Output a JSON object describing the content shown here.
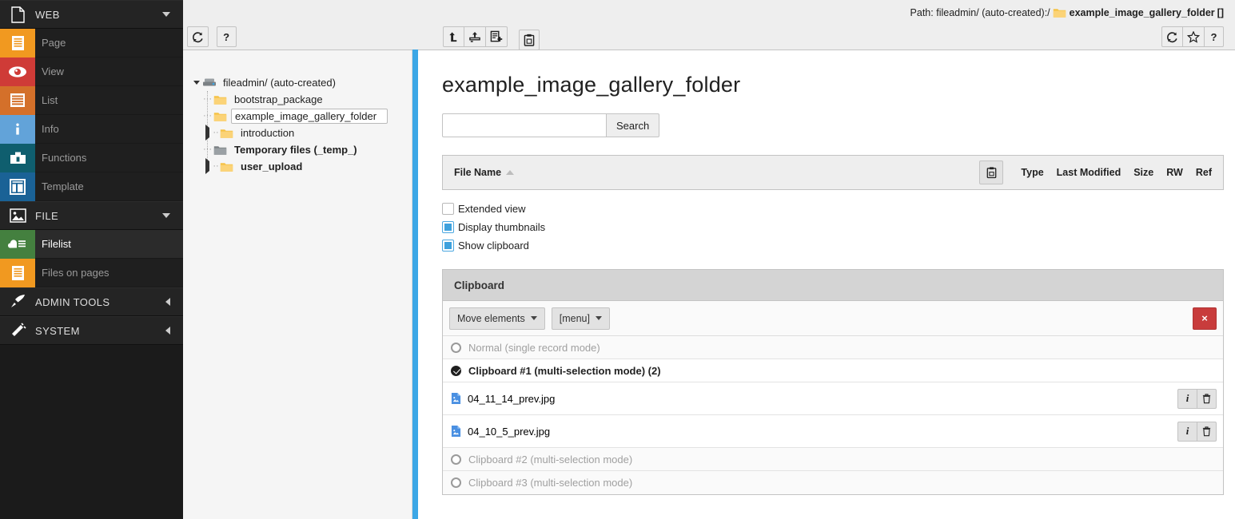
{
  "sidebar": {
    "sections": [
      {
        "key": "web",
        "label": "WEB",
        "icon": "page-doc-icon",
        "caret": "down",
        "items": [
          {
            "label": "Page",
            "icon": "page-icon",
            "color": "#f19920",
            "active": false
          },
          {
            "label": "View",
            "icon": "eye-icon",
            "color": "#cf3b37",
            "active": false
          },
          {
            "label": "List",
            "icon": "list-icon",
            "color": "#d4702a",
            "active": false
          },
          {
            "label": "Info",
            "icon": "info-icon",
            "color": "#62a3d9",
            "active": false
          },
          {
            "label": "Functions",
            "icon": "toolbox-icon",
            "color": "#0f5e6e",
            "active": false
          },
          {
            "label": "Template",
            "icon": "template-icon",
            "color": "#1a6296",
            "active": false
          }
        ]
      },
      {
        "key": "file",
        "label": "FILE",
        "icon": "image-icon",
        "caret": "down",
        "items": [
          {
            "label": "Filelist",
            "icon": "filelist-icon",
            "color": "#44803f",
            "active": true
          },
          {
            "label": "Files on pages",
            "icon": "files-on-pages-icon",
            "color": "#f19920",
            "active": false
          }
        ]
      },
      {
        "key": "admin",
        "label": "ADMIN TOOLS",
        "icon": "rocket-icon",
        "caret": "left",
        "items": []
      },
      {
        "key": "system",
        "label": "SYSTEM",
        "icon": "plug-icon",
        "caret": "left",
        "items": []
      }
    ]
  },
  "docheader": {
    "tree_toolbar": [
      {
        "name": "refresh-tree-button",
        "icon": "refresh-icon",
        "label": "↻"
      },
      {
        "name": "tree-help-button",
        "icon": "question-icon",
        "label": "?"
      }
    ],
    "main_toolbar": [
      {
        "name": "level-up-button",
        "icon": "arrow-up-level-icon"
      },
      {
        "name": "upload-files-button",
        "icon": "upload-icon"
      },
      {
        "name": "create-new-button",
        "icon": "new-document-icon"
      },
      {
        "name": "paste-clipboard-button",
        "icon": "clipboard-icon"
      }
    ],
    "right_toolbar": [
      {
        "name": "reload-button",
        "icon": "refresh-icon"
      },
      {
        "name": "bookmark-button",
        "icon": "star-icon"
      },
      {
        "name": "help-button",
        "icon": "question-icon",
        "label": "?"
      }
    ],
    "path": {
      "prefix": "Path:",
      "storage": "fileadmin/ (auto-created):/",
      "folder_icon": "folder-icon",
      "folder": "example_image_gallery_folder",
      "suffix": "[]"
    }
  },
  "tree": {
    "nodes": [
      {
        "label": "fileadmin/ (auto-created)",
        "icon": "storage-icon",
        "depth": 0,
        "expander": "down",
        "bold": false,
        "selected": false
      },
      {
        "label": "bootstrap_package",
        "icon": "folder-icon",
        "depth": 1,
        "expander": "none",
        "bold": false,
        "selected": false
      },
      {
        "label": "example_image_gallery_folder",
        "icon": "folder-icon",
        "depth": 1,
        "expander": "none",
        "bold": false,
        "selected": true
      },
      {
        "label": "introduction",
        "icon": "folder-icon",
        "depth": 1,
        "expander": "right",
        "bold": false,
        "selected": false
      },
      {
        "label": "Temporary files (_temp_)",
        "icon": "folder-temp-icon",
        "depth": 1,
        "expander": "none",
        "bold": true,
        "selected": false
      },
      {
        "label": "user_upload",
        "icon": "folder-icon",
        "depth": 1,
        "expander": "right",
        "bold": true,
        "selected": false
      }
    ]
  },
  "main": {
    "title": "example_image_gallery_folder",
    "search": {
      "value": "",
      "placeholder": "",
      "button_label": "Search"
    },
    "filetable": {
      "sort_column": "File Name",
      "sort_direction": "asc",
      "clipboard_toggle_icon": "clipboard-icon",
      "columns": [
        "Type",
        "Last Modified",
        "Size",
        "RW",
        "Ref"
      ]
    },
    "options": [
      {
        "label": "Extended view",
        "checked": false,
        "name": "extended-view-checkbox"
      },
      {
        "label": "Display thumbnails",
        "checked": true,
        "name": "display-thumbnails-checkbox"
      },
      {
        "label": "Show clipboard",
        "checked": true,
        "name": "show-clipboard-checkbox"
      }
    ],
    "clipboard": {
      "title": "Clipboard",
      "move_menu_label": "Move elements",
      "menu_label": "[menu]",
      "clear_label": "×",
      "rows": [
        {
          "type": "pad",
          "label": "Normal (single record mode)",
          "selected": false
        },
        {
          "type": "pad",
          "label": "Clipboard #1 (multi-selection mode) (2)",
          "selected": true
        },
        {
          "type": "file",
          "label": "04_11_14_prev.jpg",
          "icon": "image-file-icon",
          "actions": [
            {
              "name": "file-info-button",
              "label": "i"
            },
            {
              "name": "file-remove-button",
              "label": "trash"
            }
          ]
        },
        {
          "type": "file",
          "label": "04_10_5_prev.jpg",
          "icon": "image-file-icon",
          "actions": [
            {
              "name": "file-info-button",
              "label": "i"
            },
            {
              "name": "file-remove-button",
              "label": "trash"
            }
          ]
        },
        {
          "type": "pad",
          "label": "Clipboard #2 (multi-selection mode)",
          "selected": false
        },
        {
          "type": "pad",
          "label": "Clipboard #3 (multi-selection mode)",
          "selected": false
        }
      ]
    }
  },
  "colors": {
    "sidebar_bg": "#1b1b1b",
    "accent_blue": "#3ca7e6",
    "danger_red": "#c83c3c",
    "folder_yellow": "#f5c244",
    "panel_gray": "#eeeeee"
  }
}
